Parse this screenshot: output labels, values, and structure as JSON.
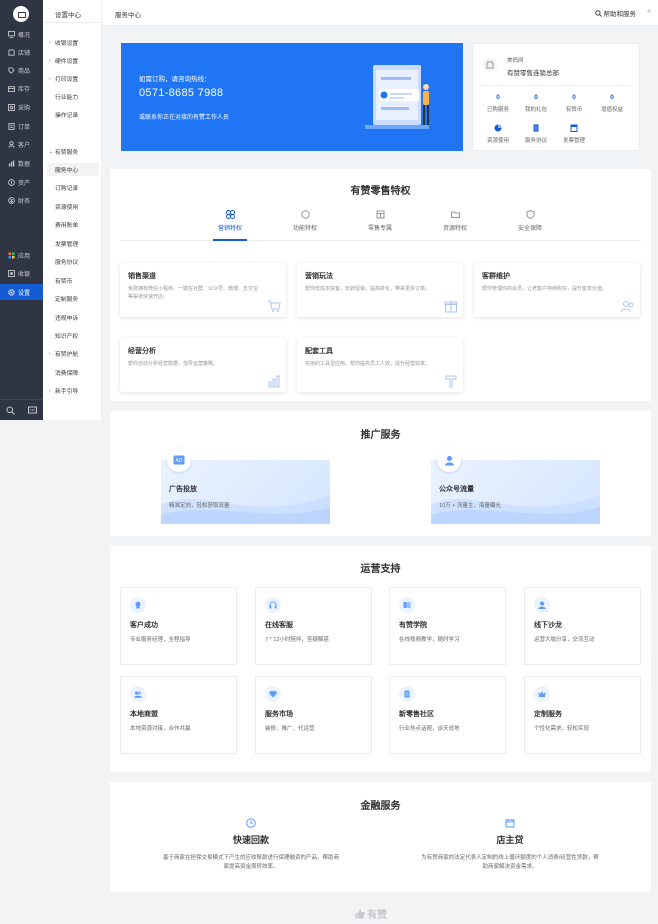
{
  "rail": {
    "items": [
      {
        "label": "概况",
        "icon": "dashboard-icon"
      },
      {
        "label": "店铺",
        "icon": "store-icon"
      },
      {
        "label": "商品",
        "icon": "tag-icon"
      },
      {
        "label": "库存",
        "icon": "inventory-icon"
      },
      {
        "label": "采购",
        "icon": "purchase-icon"
      },
      {
        "label": "订单",
        "icon": "order-icon"
      },
      {
        "label": "客户",
        "icon": "customer-icon"
      },
      {
        "label": "数据",
        "icon": "data-icon"
      },
      {
        "label": "资产",
        "icon": "asset-icon"
      },
      {
        "label": "财务",
        "icon": "finance-icon"
      },
      {
        "label": "应用",
        "icon": "apps-icon"
      },
      {
        "label": "收银",
        "icon": "cashier-icon"
      },
      {
        "label": "设置",
        "icon": "settings-icon"
      }
    ]
  },
  "subnav": {
    "title": "设置中心",
    "items": [
      {
        "label": "收银设置",
        "type": "group"
      },
      {
        "label": "硬件设置",
        "type": "group"
      },
      {
        "label": "打印设置",
        "type": "group"
      },
      {
        "label": "行业能力",
        "type": "plain"
      },
      {
        "label": "操作记录",
        "type": "plain"
      },
      {
        "label": "有赞服务",
        "type": "open"
      },
      {
        "label": "服务中心",
        "type": "sub",
        "selected": true
      },
      {
        "label": "订购记录",
        "type": "sub"
      },
      {
        "label": "资源使用",
        "type": "sub"
      },
      {
        "label": "费用账单",
        "type": "sub"
      },
      {
        "label": "发票管理",
        "type": "sub"
      },
      {
        "label": "服务协议",
        "type": "sub"
      },
      {
        "label": "有赞币",
        "type": "sub"
      },
      {
        "label": "定制服务",
        "type": "sub"
      },
      {
        "label": "违规申诉",
        "type": "sub"
      },
      {
        "label": "知识产权",
        "type": "sub"
      },
      {
        "label": "有赞护航",
        "type": "group"
      },
      {
        "label": "消费保障",
        "type": "plain"
      },
      {
        "label": "新手引导",
        "type": "group"
      }
    ]
  },
  "topbar": {
    "crumb": "服务中心",
    "help": "帮助和服务",
    "collapse": "«"
  },
  "banner": {
    "line1": "如需订购，请咨询热线：",
    "phone": "0571-8685 7988",
    "line3": "或联系你正在对接的有赞工作人员"
  },
  "shop": {
    "name": "美妈网",
    "title": "有赞零售连锁总部",
    "stats": [
      {
        "value": "0",
        "label": "已购服务"
      },
      {
        "value": "0",
        "label": "我的礼包"
      },
      {
        "value": "0",
        "label": "有赞币"
      },
      {
        "value": "0",
        "label": "增值权益"
      }
    ],
    "tools": [
      {
        "label": "资源使用",
        "icon": "pie-icon"
      },
      {
        "label": "服务协议",
        "icon": "doc-icon"
      },
      {
        "label": "发票管理",
        "icon": "invoice-icon"
      }
    ]
  },
  "privilege": {
    "title": "有赞零售特权",
    "tabs": [
      {
        "label": "营销特权",
        "icon": "marketing-icon",
        "active": true
      },
      {
        "label": "功能特权",
        "icon": "cube-icon"
      },
      {
        "label": "零售专属",
        "icon": "retail-icon"
      },
      {
        "label": "资源特权",
        "icon": "folder-icon"
      },
      {
        "label": "安全保障",
        "icon": "shield-icon"
      }
    ],
    "cards": [
      {
        "title": "销售渠道",
        "desc": "免费拥有微信小程序、一键在社群、公众号、微博、支付宝等渠道快速开店。"
      },
      {
        "title": "营销玩法",
        "desc": "帮你低成本获客，玩转促销，提高转化，带来更多订单。"
      },
      {
        "title": "客群维护",
        "desc": "帮你管理你的会员，让老客户持续购买，提升客单价值。"
      },
      {
        "title": "经营分析",
        "desc": "帮你自动分析经营数据，指导运营策略。"
      },
      {
        "title": "配套工具",
        "desc": "实用的工具型应用，帮你提高员工人效，提升经营效率。"
      }
    ]
  },
  "promo": {
    "title": "推广服务",
    "items": [
      {
        "title": "广告投放",
        "desc": "精准定向，轻松获取流量",
        "icon": "ad-icon"
      },
      {
        "title": "公众号流量",
        "desc": "10万 + 流量主，海量曝光",
        "icon": "user-icon"
      }
    ]
  },
  "ops": {
    "title": "运营支持",
    "items": [
      {
        "title": "客户成功",
        "desc": "专业服务经理，全程指导",
        "icon": "success-icon"
      },
      {
        "title": "在线客服",
        "desc": "7 * 12小时陪伴，答疑解惑",
        "icon": "headset-icon"
      },
      {
        "title": "有赞学院",
        "desc": "在线视频教学，随时学习",
        "icon": "book-icon"
      },
      {
        "title": "线下沙龙",
        "desc": "运营大咖分享，交流互动",
        "icon": "salon-icon"
      },
      {
        "title": "本地商盟",
        "desc": "本地资源对接，合作共赢",
        "icon": "alliance-icon"
      },
      {
        "title": "服务市场",
        "desc": "装修、推广、代运营",
        "icon": "heart-icon"
      },
      {
        "title": "新零售社区",
        "desc": "行业热点话题，谈天说地",
        "icon": "community-icon"
      },
      {
        "title": "定制服务",
        "desc": "个性化需求，轻松实现",
        "icon": "crown-icon"
      }
    ]
  },
  "finance": {
    "title": "金融服务",
    "items": [
      {
        "title": "快速回款",
        "desc1": "基于商家在担保交易模式下产生的应收账款进行保理融资的产品，帮助商",
        "desc2": "家提高资金周转效率。",
        "icon": "clock-icon"
      },
      {
        "title": "店主贷",
        "desc1": "为有赞商家的法定代表人定制的线上循环额度的个人消费/经营性贷款，帮",
        "desc2": "助商家解决资金需求。",
        "icon": "calendar-icon"
      }
    ]
  },
  "footer": {
    "brand": "有赞"
  },
  "colors": {
    "accent": "#155bd4",
    "banner": "#1f75f4",
    "rail": "#2f3542"
  }
}
